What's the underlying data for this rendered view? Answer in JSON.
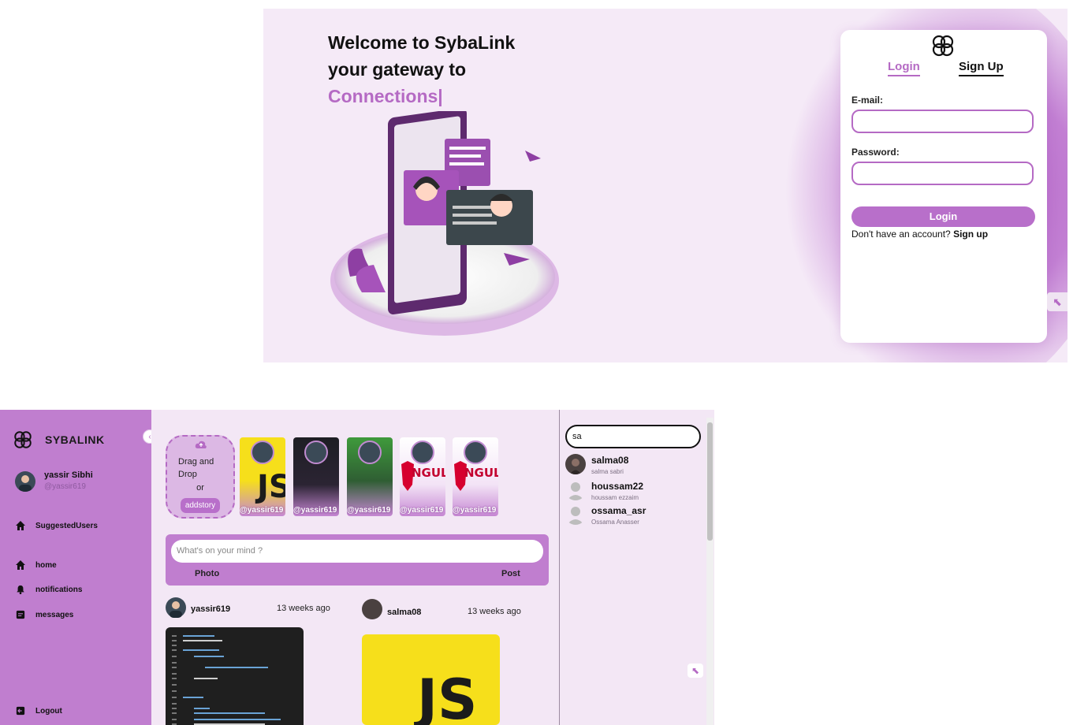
{
  "login": {
    "welcome_line1": "Welcome to SybaLink",
    "welcome_line2": "your gateway to",
    "welcome_line3": "Connections|",
    "tab_login": "Login",
    "tab_signup": "Sign Up",
    "email_label": "E-mail:",
    "password_label": "Password:",
    "login_button": "Login",
    "no_account_text": "Don't have an account?",
    "signup_link": "Sign up",
    "colors": {
      "accent": "#b56ac4",
      "background": "#f5eaf7"
    }
  },
  "feed": {
    "brand": "SYBALINK",
    "collapse_icon": "chevron-left-icon",
    "user": {
      "name": "yassir Sibhi",
      "handle": "@yassir619"
    },
    "nav": [
      {
        "label": "SuggestedUsers",
        "icon": "home-icon"
      },
      {
        "label": "home",
        "icon": "home-icon"
      },
      {
        "label": "notifications",
        "icon": "bell-icon"
      },
      {
        "label": "messages",
        "icon": "message-icon"
      }
    ],
    "logout": "Logout",
    "add_story": {
      "line1": "Drag and Drop",
      "or": "or",
      "button": "addstory"
    },
    "stories": [
      {
        "handle": "@yassir619",
        "theme": "JS"
      },
      {
        "handle": "@yassir619",
        "theme": "code"
      },
      {
        "handle": "@yassir619",
        "theme": "terminal"
      },
      {
        "handle": "@yassir619",
        "theme": "ANGULAR"
      },
      {
        "handle": "@yassir619",
        "theme": "ANGULAR"
      }
    ],
    "composer": {
      "placeholder": "What's on your mind ?",
      "photo": "Photo",
      "post": "Post"
    },
    "posts": [
      {
        "user": "yassir619",
        "time": "13 weeks ago"
      },
      {
        "user": "salma08",
        "time": "13 weeks ago"
      }
    ],
    "search": {
      "value": "sa"
    },
    "results": [
      {
        "username": "salma08",
        "fullname": "salma sabri"
      },
      {
        "username": "houssam22",
        "fullname": "houssam ezzaim"
      },
      {
        "username": "ossama_asr",
        "fullname": "Ossama Anasser"
      }
    ],
    "colors": {
      "sidebar": "#c07ecf",
      "accent": "#b86fca"
    }
  }
}
